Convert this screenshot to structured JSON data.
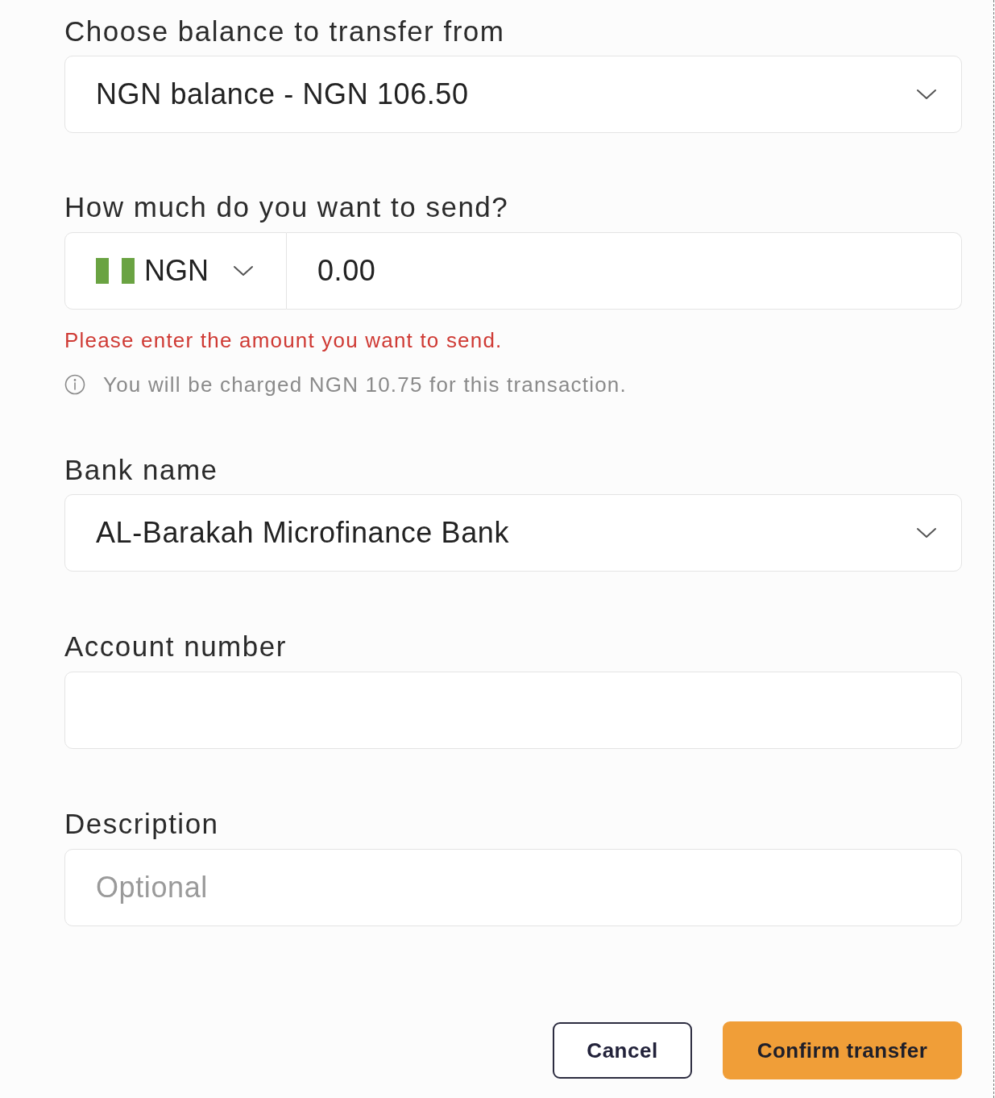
{
  "fields": [
    {
      "kind": "select",
      "label": "Choose balance to transfer from",
      "value": "NGN balance - NGN 106.50"
    },
    {
      "kind": "amount",
      "label": "How much do you want to send?",
      "currency": "NGN",
      "value": "0.00",
      "error": "Please enter the amount you want to send.",
      "note": "You will be charged NGN 10.75 for this transaction."
    },
    {
      "kind": "select",
      "label": "Bank name",
      "value": "AL-Barakah Microfinance Bank"
    },
    {
      "kind": "text",
      "label": "Account number"
    },
    {
      "kind": "text",
      "label": "Description",
      "placeholder": "Optional"
    }
  ],
  "buttons": [
    {
      "kind": "secondary",
      "label": "Cancel"
    },
    {
      "kind": "primary",
      "label": "Confirm transfer"
    }
  ]
}
